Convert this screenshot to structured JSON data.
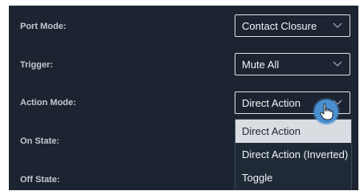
{
  "form": {
    "port_mode": {
      "label": "Port Mode:",
      "value": "Contact Closure"
    },
    "trigger": {
      "label": "Trigger:",
      "value": "Mute All"
    },
    "action_mode": {
      "label": "Action Mode:",
      "value": "Direct Action"
    },
    "on_state": {
      "label": "On State:"
    },
    "off_state": {
      "label": "Off State:"
    }
  },
  "dropdown": {
    "options": [
      "Direct Action",
      "Direct Action (Inverted)",
      "Toggle"
    ],
    "selected": "Direct Action"
  },
  "icons": {
    "chevron": "chevron-down-icon",
    "cursor": "hand-pointer-icon"
  },
  "colors": {
    "panel_bg": "#1b2430",
    "label_text": "#c2c9d2",
    "select_border": "#dfe3e8",
    "option_highlight": "#d9dde2",
    "cursor_accent": "#4a8fd0"
  }
}
